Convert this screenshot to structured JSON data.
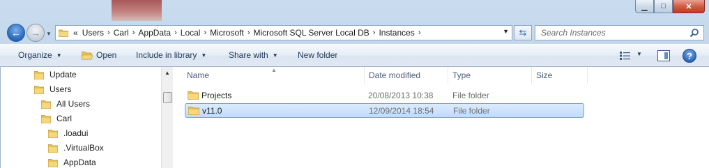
{
  "window": {
    "minimize": "▁",
    "maximize": "□",
    "close": "✕"
  },
  "address": {
    "lead": "«",
    "separator": "›",
    "crumbs": [
      "Users",
      "Carl",
      "AppData",
      "Local",
      "Microsoft",
      "Microsoft SQL Server Local DB",
      "Instances"
    ]
  },
  "search": {
    "placeholder": "Search Instances"
  },
  "toolbar": {
    "organize": "Organize",
    "open": "Open",
    "include_in_library": "Include in library",
    "share_with": "Share with",
    "new_folder": "New folder",
    "help": "?"
  },
  "tree": [
    {
      "label": "Update",
      "indent": 0
    },
    {
      "label": "Users",
      "indent": 0
    },
    {
      "label": "All Users",
      "indent": 1
    },
    {
      "label": "Carl",
      "indent": 1
    },
    {
      "label": ".loadui",
      "indent": 2
    },
    {
      "label": ".VirtualBox",
      "indent": 2
    },
    {
      "label": "AppData",
      "indent": 2
    }
  ],
  "columns": [
    "Name",
    "Date modified",
    "Type",
    "Size"
  ],
  "files": [
    {
      "name": "Projects",
      "date": "20/08/2013 10:38",
      "type": "File folder",
      "size": "",
      "selected": false
    },
    {
      "name": "v11.0",
      "date": "12/09/2014 18:54",
      "type": "File folder",
      "size": "",
      "selected": true
    }
  ],
  "colors": {
    "folder": "#e8c15a",
    "selection": "#c1dbfc",
    "accent": "#2f6fc0"
  }
}
